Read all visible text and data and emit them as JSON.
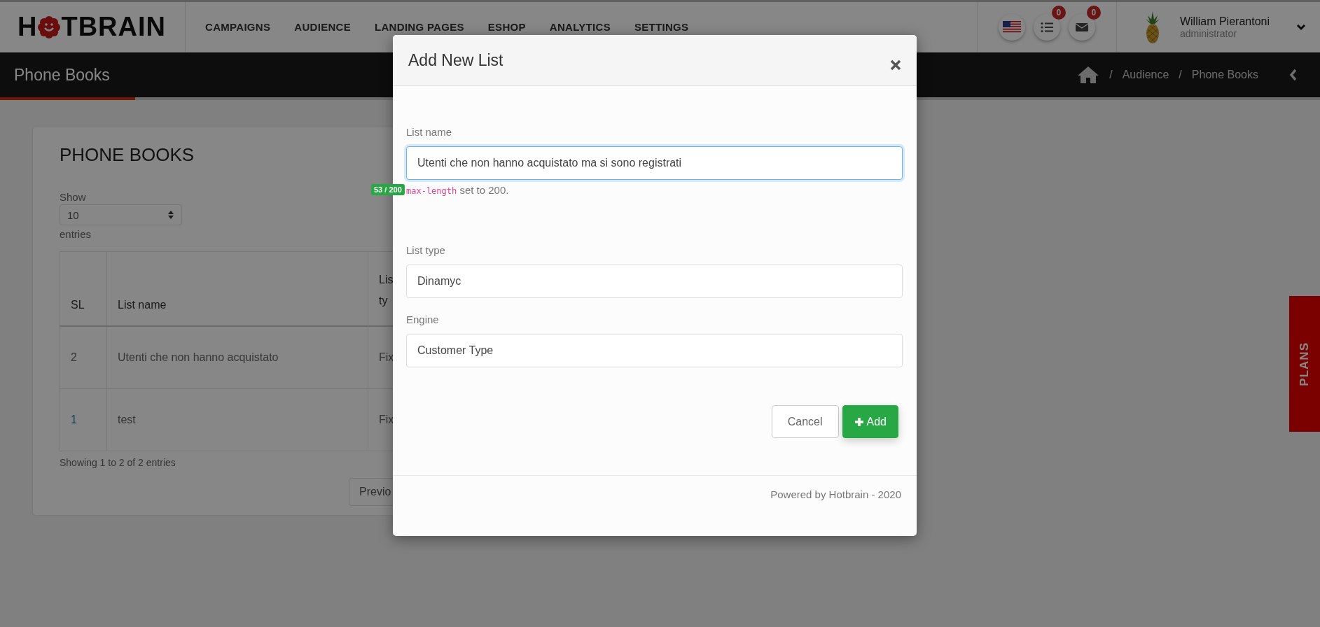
{
  "logo": {
    "lead": "H",
    "tail": "TBRAIN"
  },
  "nav": [
    "CAMPAIGNS",
    "AUDIENCE",
    "LANDING PAGES",
    "ESHOP",
    "ANALYTICS",
    "SETTINGS"
  ],
  "notifications": {
    "tasks_count": "0",
    "mail_count": "0"
  },
  "user": {
    "name": "William Pierantoni",
    "role": "administrator"
  },
  "page_title": "Phone Books",
  "breadcrumb": [
    {
      "sep": "/",
      "label": "Audience"
    },
    {
      "sep": "/",
      "label": "Phone Books"
    }
  ],
  "card": {
    "title": "PHONE BOOKS",
    "show_label": "Show",
    "page_size": "10",
    "entries_label": "entries",
    "table": {
      "columns": [
        [
          "SL"
        ],
        [
          "List name"
        ],
        [
          "Lis",
          "ty"
        ]
      ],
      "rows": [
        {
          "sl": "2",
          "name": "Utenti che non hanno acquistato",
          "column_3": "Fix",
          "linked": false
        },
        {
          "sl": "1",
          "name": "test",
          "column_3": "Fix",
          "linked": true
        }
      ]
    },
    "info": "Showing 1 to 2 of 2 entries",
    "pager_button": "Previo"
  },
  "plans_tab": "PLANS",
  "modal": {
    "title": "Add New List",
    "fields": [
      {
        "label": "List name",
        "value": "Utenti che non hanno acquistato ma si sono registrati",
        "focused": true,
        "counter": "53 / 200",
        "hint_code": "max-length",
        "hint_text": "set to 200."
      },
      {
        "label": "List type",
        "value": "Dinamyc",
        "focused": false
      },
      {
        "label": "Engine",
        "value": "Customer Type",
        "focused": false
      }
    ],
    "buttons": [
      {
        "label": "Cancel",
        "kind": "secondary"
      },
      {
        "label": "Add",
        "kind": "primary"
      }
    ],
    "footer": "Powered by Hotbrain - 2020"
  }
}
